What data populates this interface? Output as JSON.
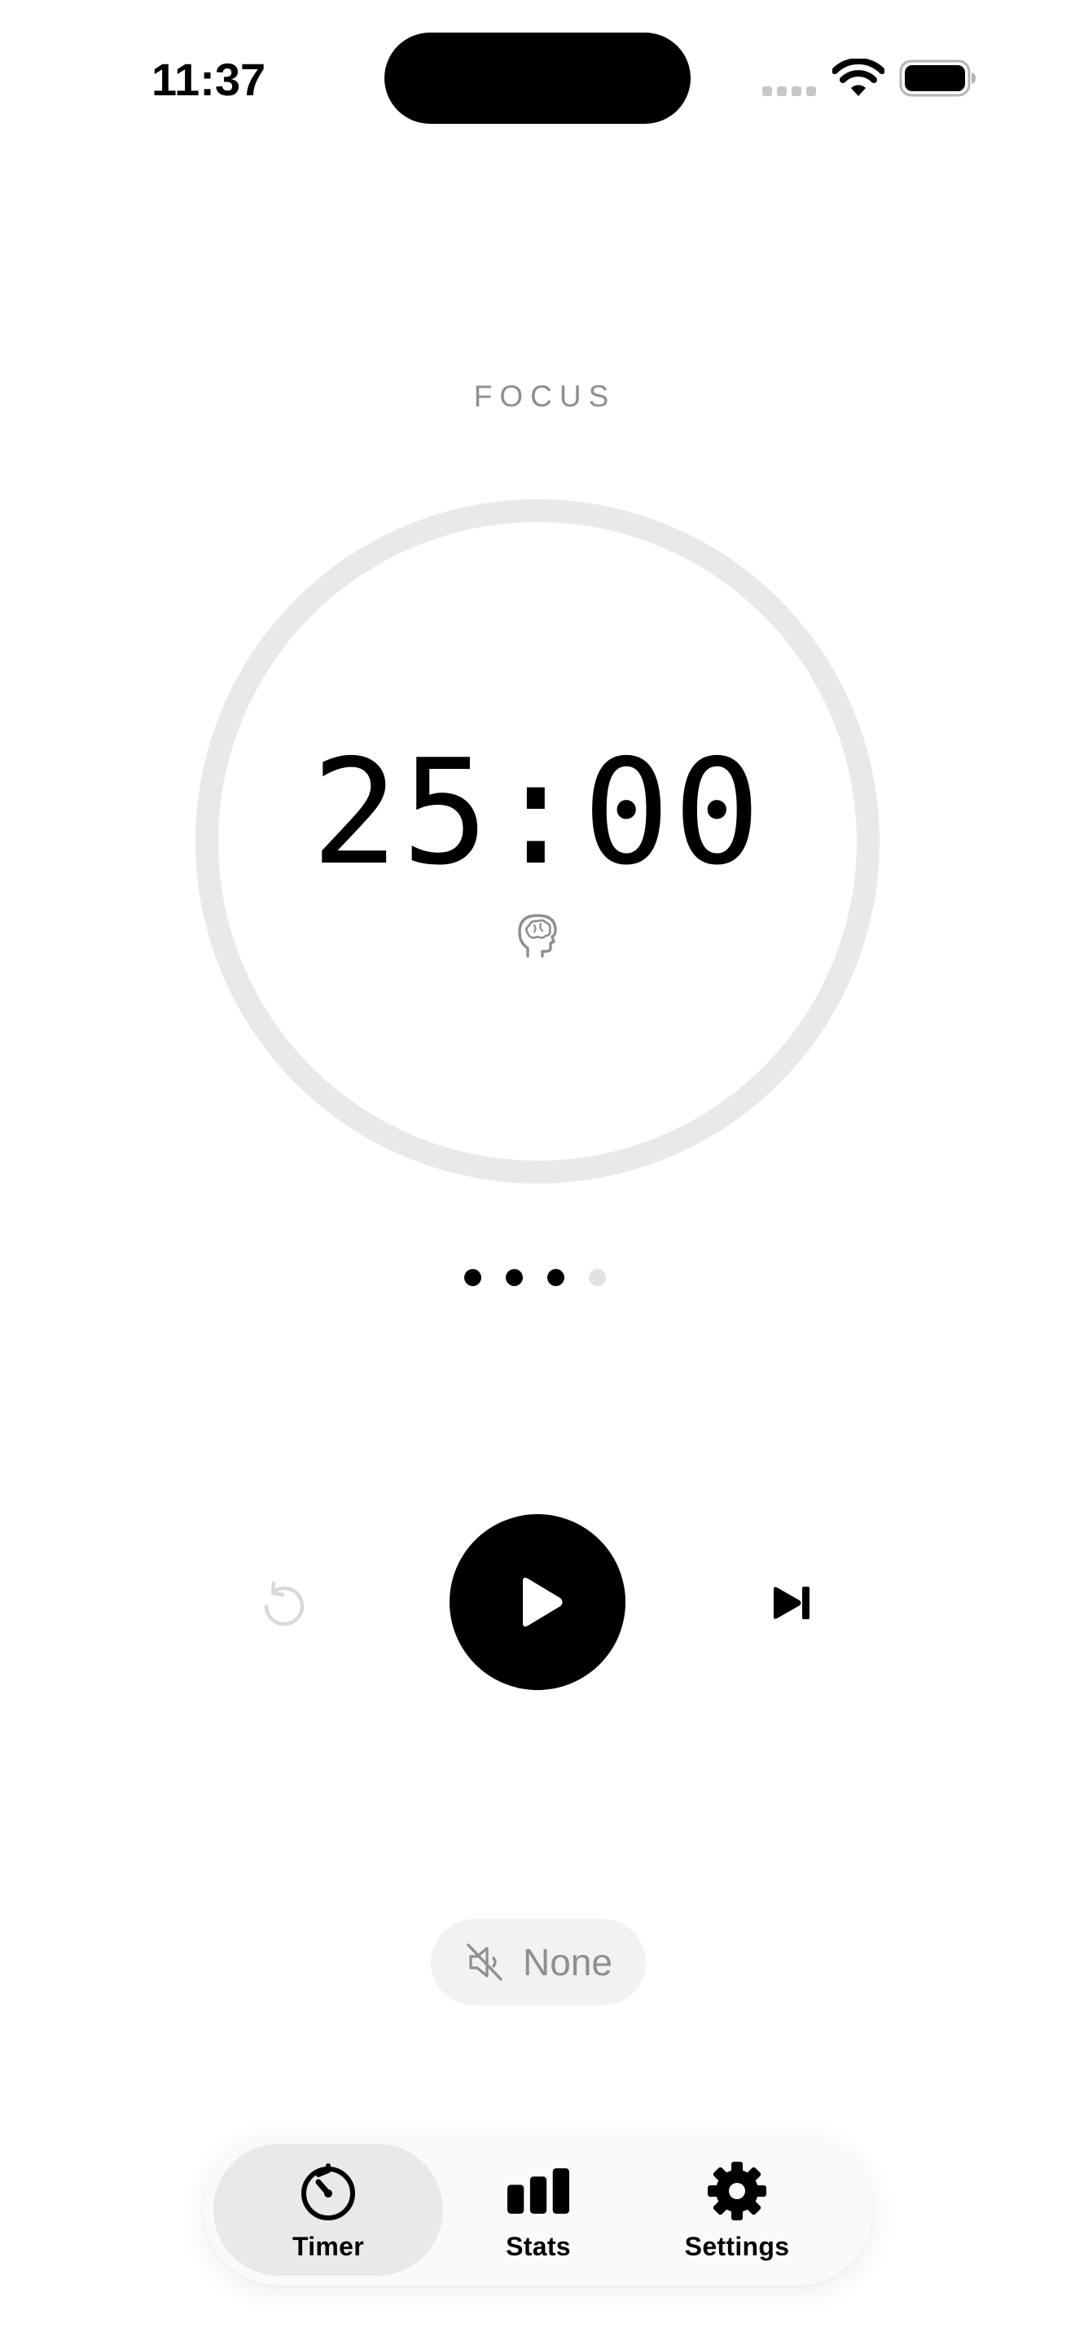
{
  "status_bar": {
    "time": "11:37",
    "icons": [
      "cellular-signal-icon",
      "wifi-icon",
      "battery-icon"
    ]
  },
  "timer": {
    "mode_label": "FOCUS",
    "time_remaining": "25:00",
    "mode_icon": "brain-head-icon",
    "progress": 0.0,
    "sessions_completed": 3,
    "sessions_total": 4
  },
  "controls": {
    "reset_icon": "reset-icon",
    "play_icon": "play-icon",
    "skip_icon": "skip-forward-icon"
  },
  "sound": {
    "label": "None",
    "icon": "speaker-muted-icon"
  },
  "tab_bar": {
    "active": "timer",
    "tabs": [
      {
        "id": "timer",
        "label": "Timer",
        "icon": "stopwatch-icon"
      },
      {
        "id": "stats",
        "label": "Stats",
        "icon": "bar-chart-icon"
      },
      {
        "id": "settings",
        "label": "Settings",
        "icon": "gear-icon"
      }
    ]
  },
  "colors": {
    "background": "#ffffff",
    "primary": "#000000",
    "secondary_text": "#8e8e93",
    "ring_track": "#e9e9e9",
    "pill_background": "#f2f2f2",
    "active_tab": "#e9e9e9"
  }
}
